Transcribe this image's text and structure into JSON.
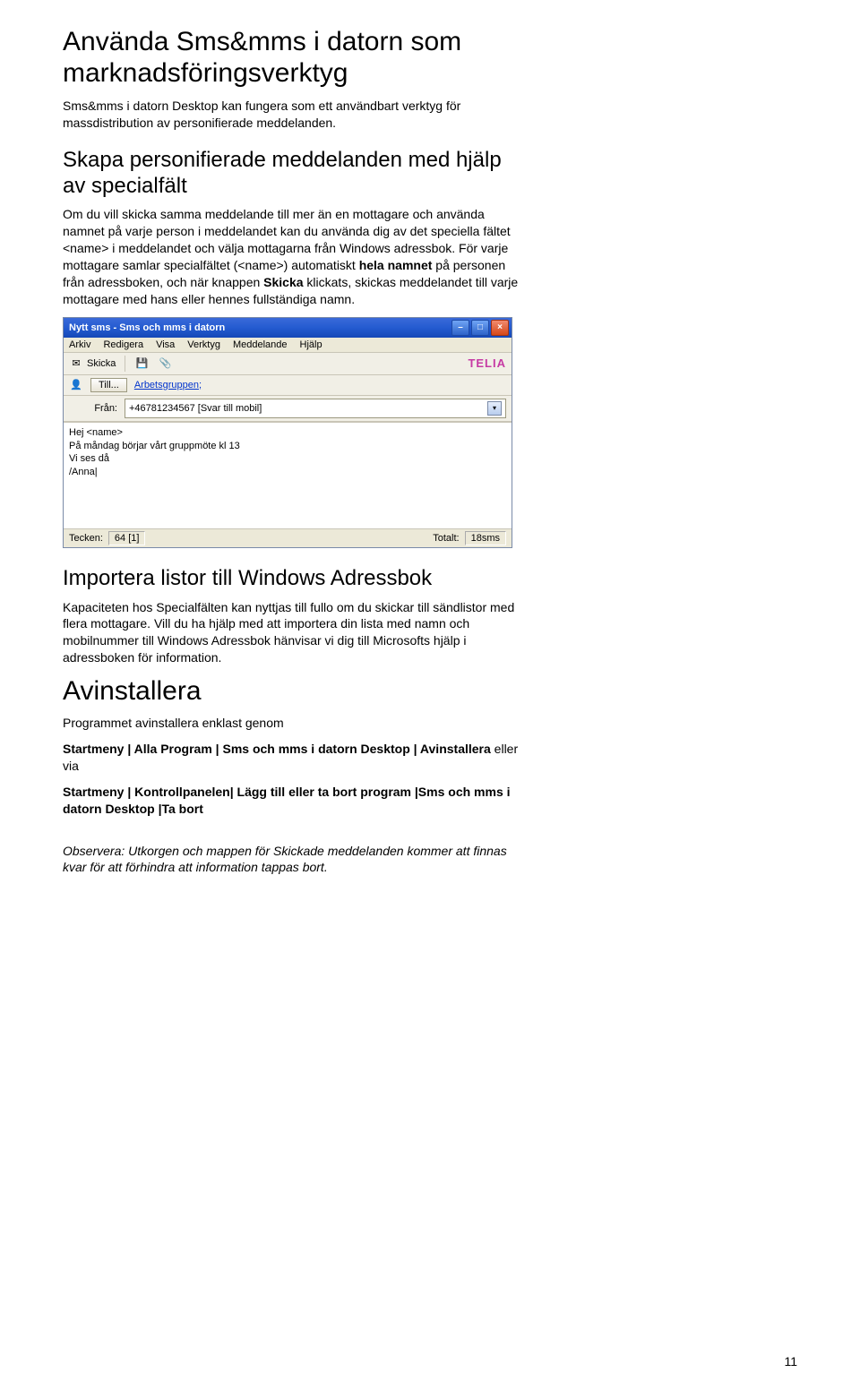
{
  "heading1": "Använda Sms&mms i datorn som marknadsföringsverktyg",
  "intro": "Sms&mms i datorn Desktop kan fungera som ett användbart verktyg för massdistribution av personifierade meddelanden.",
  "heading2": "Skapa personifierade meddelanden med hjälp av specialfält",
  "para2_part1": "Om du vill skicka samma meddelande till mer än en mottagare och använda namnet på varje person i meddelandet kan du använda dig av det speciella fältet <name> i meddelandet och välja mottagarna från Windows adressbok. För varje mottagare samlar specialfältet (<name>) automatiskt ",
  "para2_bold1": "hela namnet",
  "para2_part2": " på personen från adressboken, och när knappen ",
  "para2_bold2": "Skicka",
  "para2_part3": " klickats, skickas meddelandet till varje mottagare med hans eller hennes fullständiga namn.",
  "screenshot": {
    "title": "Nytt sms - Sms och mms i datorn",
    "menu": {
      "arkiv": "Arkiv",
      "redigera": "Redigera",
      "visa": "Visa",
      "verktyg": "Verktyg",
      "meddelande": "Meddelande",
      "hjalp": "Hjälp"
    },
    "toolbar": {
      "skicka": "Skicka"
    },
    "brand": "TELIA",
    "till_button": "Till...",
    "till_value": "Arbetsgruppen;",
    "from_label": "Från:",
    "from_value": "+46781234567 [Svar till mobil]",
    "body": "Hej <name>\nPå måndag börjar vårt gruppmöte kl 13\nVi ses då\n/Anna|",
    "status_tecken_label": "Tecken:",
    "status_tecken_value": "64 [1]",
    "status_totalt_label": "Totalt:",
    "status_totalt_value": "18sms"
  },
  "heading3": "Importera listor till Windows Adressbok",
  "para3": "Kapaciteten hos Specialfälten kan nyttjas till fullo om du skickar till sändlistor med flera mottagare. Vill du ha hjälp med att importera din lista med namn och mobilnummer till Windows Adressbok hänvisar vi dig till Microsofts hjälp i adressboken för information.",
  "heading4": "Avinstallera",
  "para4": "Programmet avinstallera enklast genom",
  "path1": "Startmeny | Alla Program | Sms och mms i datorn Desktop | Avinstallera",
  "path1_suffix": " eller via",
  "path2": "Startmeny | Kontrollpanelen| Lägg till eller ta bort program |Sms och mms i datorn Desktop |Ta bort",
  "note": "Observera: Utkorgen och mappen för Skickade meddelanden kommer att finnas kvar för att förhindra att information tappas bort.",
  "page_number": "11"
}
